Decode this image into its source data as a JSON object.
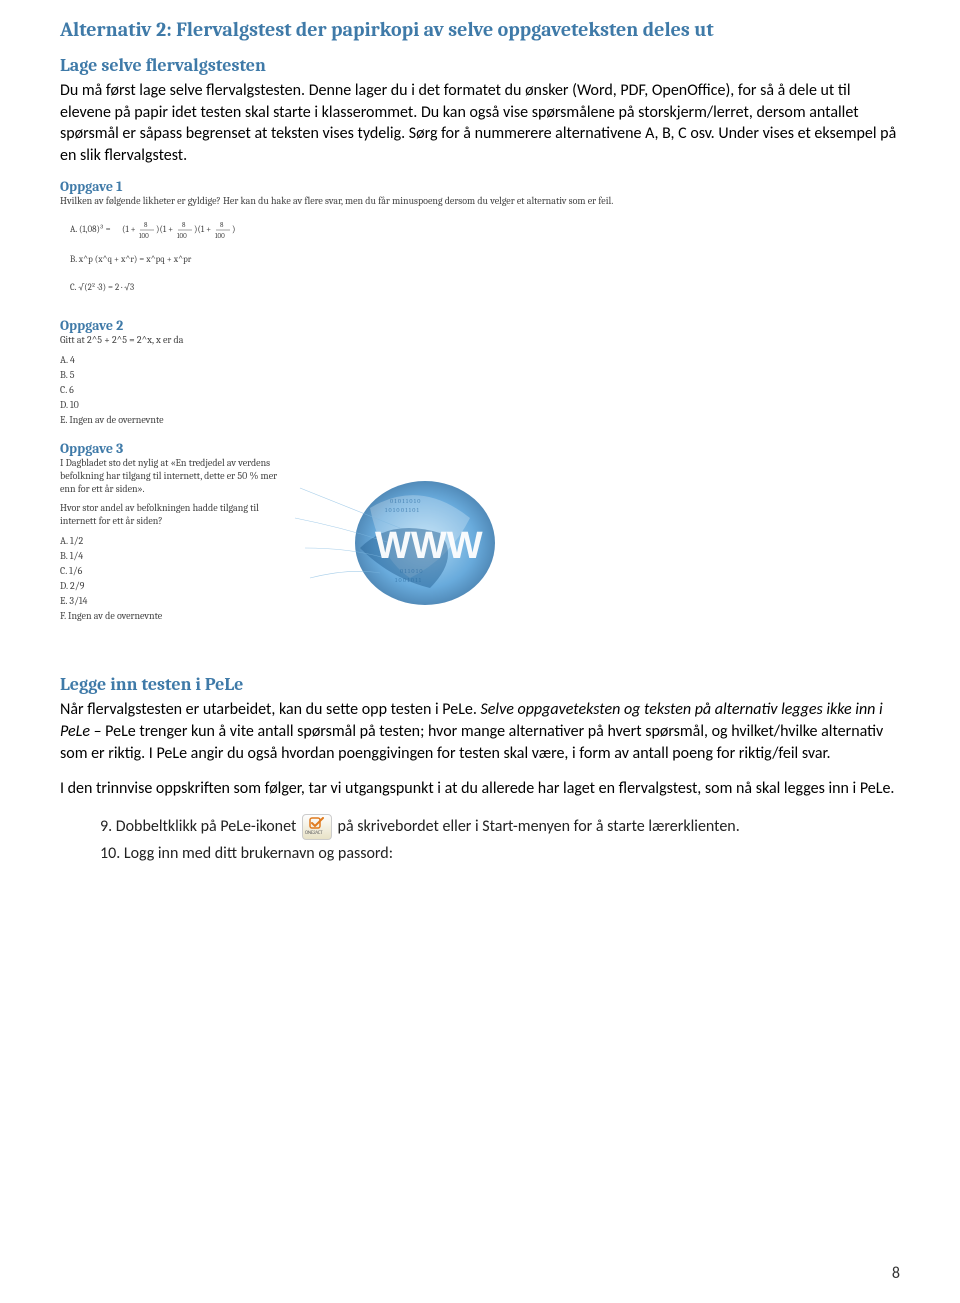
{
  "title": "Alternativ 2: Flervalgstest der papirkopi av selve oppgaveteksten deles ut",
  "section1": {
    "heading": "Lage selve flervalgstesten",
    "para": "Du må først lage selve flervalgstesten. Denne lager du i det formatet du ønsker (Word, PDF, OpenOffice), for så å dele ut til elevene på papir idet testen skal starte i klasserommet. Du kan også vise spørsmålene på storskjerm/lerret, dersom antallet spørsmål er såpass begrenset at teksten vises tydelig. Sørg for å nummerere alternativene A, B, C osv. Under vises et eksempel på en slik flervalgstest."
  },
  "example": {
    "opp1": {
      "title": "Oppgave 1",
      "text": "Hvilken av følgende likheter er gyldige? Her kan du hake av flere svar, men du får minuspoeng dersom du velger et alternativ som er feil."
    },
    "opp2": {
      "title": "Oppgave 2",
      "text": "Gitt at 2^5 + 2^5 = 2^x, x er da",
      "A": "A. 4",
      "B": "B. 5",
      "C": "C. 6",
      "D": "D. 10",
      "E": "E. Ingen av de overnevnte"
    },
    "opp3": {
      "title": "Oppgave 3",
      "text1": "I Dagbladet sto det nylig at «En tredjedel av verdens befolkning har tilgang til internett, dette er 50 % mer enn for ett år siden».",
      "text2": "Hvor stor andel av befolkningen hadde tilgang til internett for ett år siden?",
      "A": "A. 1/2",
      "B": "B. 1/4",
      "C": "C. 1/6",
      "D": "D. 2/9",
      "E": "E. 3/14",
      "F": "F. Ingen av de overnevnte"
    }
  },
  "section2": {
    "heading": "Legge inn testen i PeLe",
    "para1a": "Når flervalgstesten er utarbeidet, kan du sette opp testen i PeLe. ",
    "para1b_italic": "Selve oppgaveteksten og teksten på alternativ legges ikke inn i PeLe",
    "para1c": " – PeLe trenger kun å vite antall spørsmål på testen; hvor mange alternativer på hvert spørsmål, og hvilket/hvilke alternativ som er riktig. I PeLe angir du også hvordan poenggivingen for testen skal være, i form av antall poeng for riktig/feil svar.",
    "para2": "I den trinnvise oppskriften som følger, tar vi utgangspunkt i at du allerede har laget en flervalgstest, som nå skal legges inn i PeLe.",
    "step9a": "9.   Dobbeltklikk på PeLe-ikonet",
    "step9b": "på skrivebordet eller i Start-menyen for å starte lærerklienten.",
    "step10": "10. Logg inn med ditt brukernavn og passord:",
    "iconLabel": "ONE2ACT"
  },
  "pageNumber": "8"
}
